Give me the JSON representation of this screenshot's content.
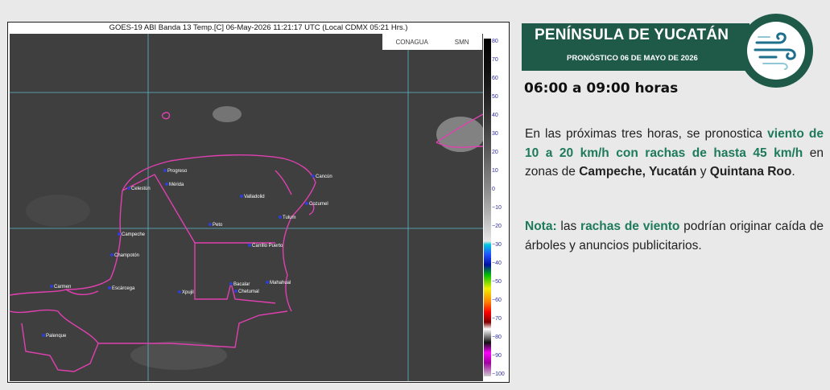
{
  "satellite": {
    "caption": "GOES-19 ABI Banda 13 Temp.[C] 06-May-2026 11:21:17 UTC (Local CDMX  05:21 Hrs.)",
    "logos": {
      "conagua": "CONAGUA",
      "smn": "SMN"
    },
    "colorbar_ticks": [
      "80",
      "70",
      "60",
      "50",
      "40",
      "30",
      "20",
      "10",
      "0",
      "−10",
      "−20",
      "−30",
      "−40",
      "−50",
      "−60",
      "−70",
      "−80",
      "−90",
      "−100"
    ],
    "cities": {
      "progreso": "Progreso",
      "merida": "Mérida",
      "celestun": "Celestún",
      "valladolid": "Valladolid",
      "cancun": "Cancún",
      "cozumel": "Cozumel",
      "tulum": "Tulum",
      "peto": "Peto",
      "campeche": "Campeche",
      "carrillo": "Carrillo Puerto",
      "champoton": "Champotón",
      "carmen": "Carmen",
      "escarcega": "Escárcega",
      "xpujil": "Xpujil",
      "bacalar": "Bacalar",
      "chetumal": "Chetumal",
      "mahahual": "Mahahual",
      "palenque": "Palenque"
    }
  },
  "header": {
    "title": "PENÍNSULA DE YUCATÁN",
    "subtitle": "PRONÓSTICO 06 DE MAYO DE  2026",
    "icon": "wind-icon",
    "accent_color": "#1e5a47"
  },
  "forecast": {
    "time_range": "06:00 a 09:00 horas",
    "p1_a": "En las próximas tres horas, se pronostica ",
    "p1_b": "viento de 10 a 20 km/h con rachas de hasta 45 km/h",
    "p1_c": " en zonas de ",
    "p1_d": "Campeche, Yucatán",
    "p1_e": " y ",
    "p1_f": "Quintana Roo",
    "p1_g": ".",
    "note_label": "Nota:",
    "note_a": " las ",
    "note_b": "rachas de viento",
    "note_c": " podrían originar caída de árboles y anuncios publicitarios."
  }
}
